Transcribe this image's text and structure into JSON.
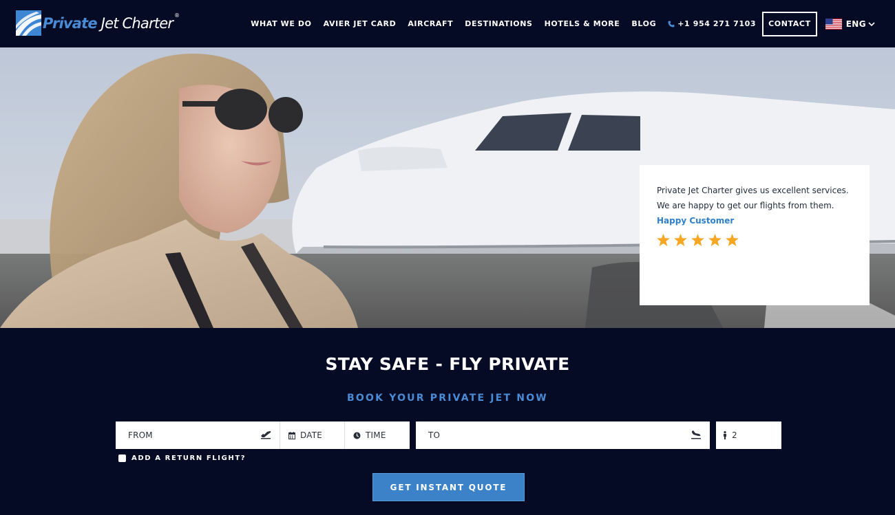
{
  "header": {
    "logo_text_a": "Private",
    "logo_text_b": " Jet Charter",
    "logo_reg": "®",
    "nav": [
      {
        "label": "WHAT WE DO"
      },
      {
        "label": "AVIER JET CARD"
      },
      {
        "label": "AIRCRAFT"
      },
      {
        "label": "DESTINATIONS"
      },
      {
        "label": "HOTELS & MORE"
      },
      {
        "label": "BLOG"
      }
    ],
    "phone": "+1 954 271 7103",
    "contact": "CONTACT",
    "language": "ENG",
    "phone_icon": "phone-icon",
    "flag_icon": "us-flag-icon",
    "chevron_icon": "chevron-down-icon"
  },
  "testimonial": {
    "line1": "Private Jet Charter gives us excellent services.",
    "line2": "We are happy to get our flights from them.",
    "author": "Happy Customer",
    "rating": 5,
    "star_color": "#f5a623",
    "author_color": "#2f7fcb"
  },
  "booking": {
    "title": "STAY SAFE - FLY PRIVATE",
    "subtitle": "BOOK YOUR PRIVATE JET NOW",
    "from_placeholder": "FROM",
    "date_placeholder": "DATE",
    "time_placeholder": "TIME",
    "to_placeholder": "TO",
    "passengers": "2",
    "return_label": "ADD A RETURN FLIGHT?",
    "return_checked": false,
    "button": "GET INSTANT QUOTE",
    "accent_color": "#3b82c8",
    "background_color": "#050b24"
  }
}
